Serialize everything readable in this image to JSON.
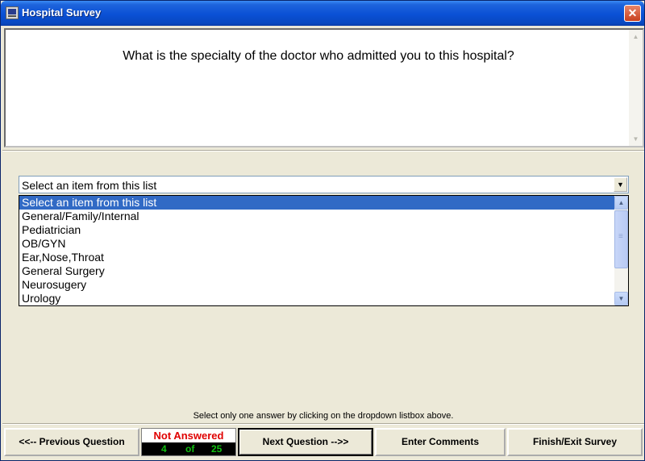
{
  "window": {
    "title": "Hospital Survey",
    "close_symbol": "✕"
  },
  "question": {
    "text": "What is the specialty of the doctor who admitted you to this hospital?"
  },
  "answer": {
    "selected_value": "Select an item from this list",
    "options": [
      "Select an item from this list",
      "General/Family/Internal",
      "Pediatrician",
      "OB/GYN",
      "Ear,Nose,Throat",
      "General Surgery",
      "Neurosugery",
      "Urology"
    ]
  },
  "hint": "Select only one answer by clicking on the dropdown listbox above.",
  "footer": {
    "previous_label": "<<-- Previous Question",
    "next_label": "Next Question -->>",
    "comments_label": "Enter Comments",
    "finish_label": "Finish/Exit Survey",
    "status": "Not Answered",
    "current": "4",
    "of_label": "of",
    "total": "25"
  },
  "colors": {
    "status_text": "#E00000",
    "counter_text": "#10C010",
    "selection": "#316AC5"
  }
}
